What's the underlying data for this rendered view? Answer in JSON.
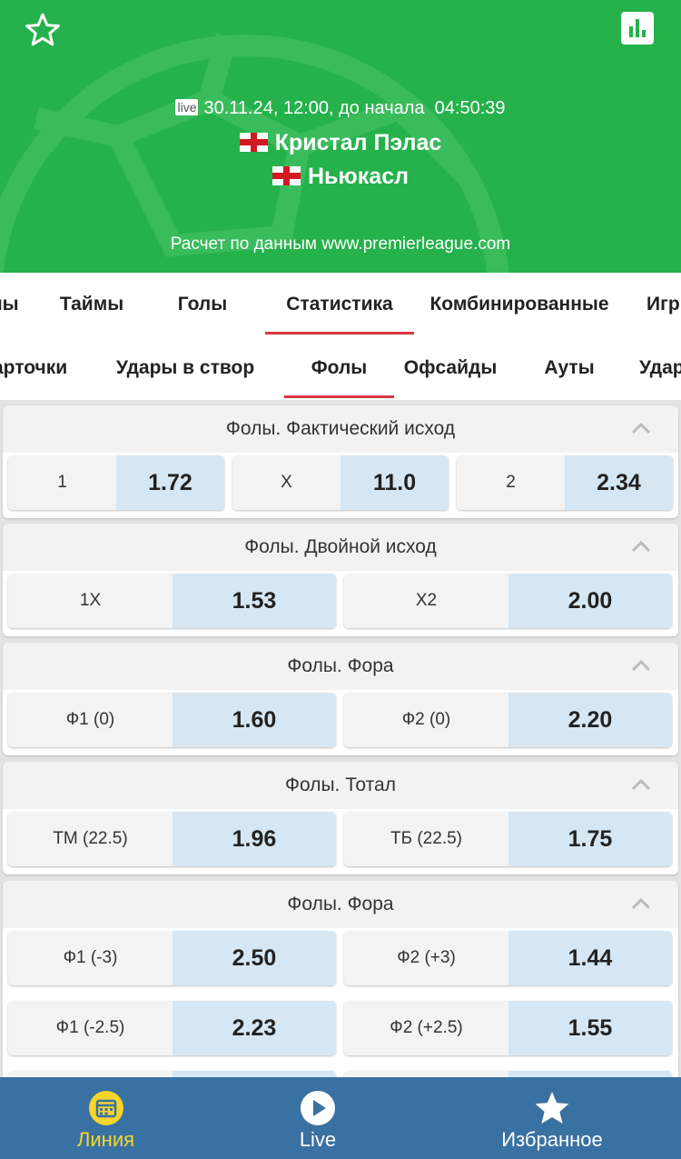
{
  "header": {
    "live_tag": "live",
    "datetime": "30.11.24, 12:00, до начала",
    "countdown": "04:50:39",
    "team_home": "Кристал Пэлас",
    "team_away": "Ньюкасл",
    "source": "Расчет по данным www.premierleague.com"
  },
  "tabs_primary": [
    "ны",
    "Таймы",
    "Голы",
    "Статистика",
    "Комбинированные",
    "Игр"
  ],
  "tabs_secondary": [
    "арточки",
    "Удары в створ",
    "Фолы",
    "Офсайды",
    "Ауты",
    "Удар"
  ],
  "markets": [
    {
      "title": "Фолы. Фактический исход",
      "rows": [
        [
          {
            "label": "1",
            "value": "1.72"
          },
          {
            "label": "X",
            "value": "11.0"
          },
          {
            "label": "2",
            "value": "2.34"
          }
        ]
      ]
    },
    {
      "title": "Фолы. Двойной исход",
      "rows": [
        [
          {
            "label": "1X",
            "value": "1.53"
          },
          {
            "label": "X2",
            "value": "2.00"
          }
        ]
      ]
    },
    {
      "title": "Фолы. Фора",
      "rows": [
        [
          {
            "label": "Ф1 (0)",
            "value": "1.60"
          },
          {
            "label": "Ф2 (0)",
            "value": "2.20"
          }
        ]
      ]
    },
    {
      "title": "Фолы. Тотал",
      "rows": [
        [
          {
            "label": "ТМ (22.5)",
            "value": "1.96"
          },
          {
            "label": "ТБ (22.5)",
            "value": "1.75"
          }
        ]
      ]
    },
    {
      "title": "Фолы. Фора",
      "rows": [
        [
          {
            "label": "Ф1 (-3)",
            "value": "2.50"
          },
          {
            "label": "Ф2 (+3)",
            "value": "1.44"
          }
        ],
        [
          {
            "label": "Ф1 (-2.5)",
            "value": "2.23"
          },
          {
            "label": "Ф2 (+2.5)",
            "value": "1.55"
          }
        ]
      ]
    }
  ],
  "bottom_nav": [
    {
      "label": "Линия",
      "icon": "calendar-icon"
    },
    {
      "label": "Live",
      "icon": "play-icon"
    },
    {
      "label": "Избранное",
      "icon": "star-icon"
    }
  ],
  "colors": {
    "header_green": "#25b14b",
    "tab_active": "#d9363e",
    "nav_blue": "#3a71a3",
    "nav_active": "#f5d52a",
    "odd_value_bg": "#d6e7f3"
  }
}
